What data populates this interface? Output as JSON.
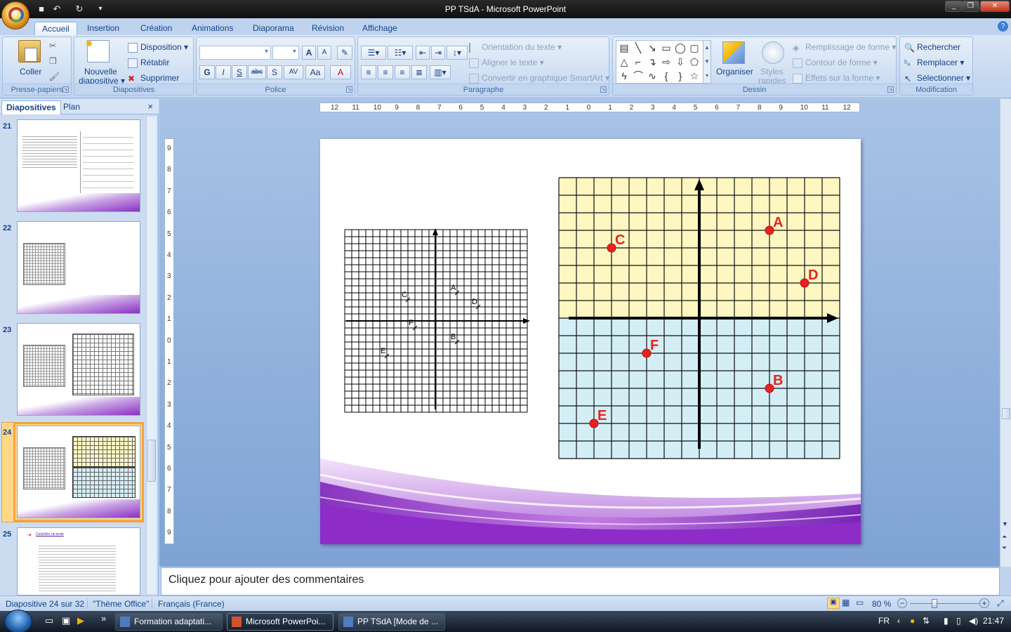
{
  "window": {
    "title": "PP TSdA - Microsoft PowerPoint"
  },
  "ribbon": {
    "tabs": [
      "Accueil",
      "Insertion",
      "Création",
      "Animations",
      "Diaporama",
      "Révision",
      "Affichage"
    ],
    "clipboard": {
      "label": "Presse-papiers",
      "paste": "Coller"
    },
    "slides": {
      "label": "Diapositives",
      "new_slide": "Nouvelle\ndiapositive",
      "new_slide_l1": "Nouvelle",
      "new_slide_l2": "diapositive",
      "layout": "Disposition",
      "reset": "Rétablir",
      "delete": "Supprimer"
    },
    "font": {
      "label": "Police",
      "bold": "G",
      "italic": "I",
      "underline": "S",
      "strike": "abc",
      "shadow": "S",
      "spacing": "AV",
      "case": "Aa",
      "color": "A",
      "grow": "A",
      "shrink": "A"
    },
    "paragraph": {
      "label": "Paragraphe",
      "text_direction": "Orientation du texte",
      "align_text": "Aligner le texte",
      "smartart": "Convertir en graphique SmartArt"
    },
    "drawing": {
      "label": "Dessin",
      "arrange": "Organiser",
      "quick_styles_l1": "Styles",
      "quick_styles_l2": "rapides",
      "fill": "Remplissage de forme",
      "outline": "Contour de forme",
      "effects": "Effets sur la forme"
    },
    "editing": {
      "label": "Modification",
      "find": "Rechercher",
      "replace": "Remplacer",
      "select": "Sélectionner"
    }
  },
  "left_pane": {
    "tabs": [
      "Diapositives",
      "Plan"
    ],
    "close": "×",
    "slides": [
      {
        "number": "21"
      },
      {
        "number": "22"
      },
      {
        "number": "23"
      },
      {
        "number": "24",
        "selected": true
      },
      {
        "number": "25",
        "heading": "Contrôler un texte"
      }
    ]
  },
  "ruler": {
    "h_ticks": [
      "12",
      "11",
      "10",
      "9",
      "8",
      "7",
      "6",
      "5",
      "4",
      "3",
      "2",
      "1",
      "0",
      "1",
      "2",
      "3",
      "4",
      "5",
      "6",
      "7",
      "8",
      "9",
      "10",
      "11",
      "12"
    ],
    "v_ticks": [
      "9",
      "8",
      "7",
      "6",
      "5",
      "4",
      "3",
      "2",
      "1",
      "0",
      "1",
      "2",
      "3",
      "4",
      "5",
      "6",
      "7",
      "8",
      "9"
    ]
  },
  "slide": {
    "left_grid": {
      "points": [
        {
          "label": "A",
          "x": 3,
          "y": 4
        },
        {
          "label": "B",
          "x": 3,
          "y": -3
        },
        {
          "label": "C",
          "x": -4,
          "y": 3
        },
        {
          "label": "D",
          "x": 6,
          "y": 2
        },
        {
          "label": "E",
          "x": -7,
          "y": -5
        },
        {
          "label": "F",
          "x": -3,
          "y": -1
        }
      ]
    },
    "right_grid": {
      "top_color": "#fff7c2",
      "bottom_color": "#d4eef6",
      "point_color": "#e8231f",
      "points": [
        {
          "label": "A",
          "x": 4,
          "y": 5
        },
        {
          "label": "B",
          "x": 4,
          "y": -4
        },
        {
          "label": "C",
          "x": -5,
          "y": 4
        },
        {
          "label": "D",
          "x": 6,
          "y": 2
        },
        {
          "label": "E",
          "x": -6,
          "y": -6
        },
        {
          "label": "F",
          "x": -3,
          "y": -2
        }
      ]
    }
  },
  "notes": {
    "placeholder": "Cliquez pour ajouter des commentaires"
  },
  "status": {
    "slide_info": "Diapositive 24 sur 32",
    "theme": "\"Thème Office\"",
    "language": "Français (France)",
    "zoom": "80 %"
  },
  "taskbar": {
    "buttons": [
      "Formation adaptati...",
      "Microsoft PowerPoi...",
      "PP TSdA [Mode de ..."
    ],
    "lang": "FR",
    "clock": "21:47"
  }
}
